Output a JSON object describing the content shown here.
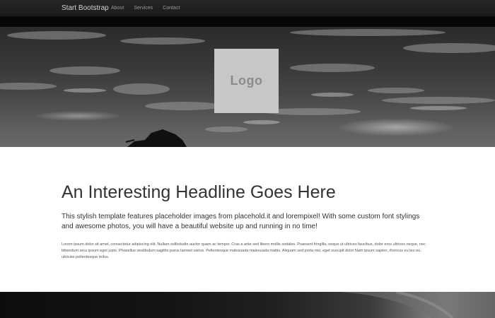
{
  "navbar": {
    "brand": "Start Bootstrap",
    "links": [
      {
        "label": "About"
      },
      {
        "label": "Services"
      },
      {
        "label": "Contact"
      }
    ]
  },
  "hero": {
    "logo_text": "Logo"
  },
  "content": {
    "headline": "An Interesting Headline Goes Here",
    "lead": "This stylish template features placeholder images from placehold.it and lorempixel! With some custom font stylings and awesome photos, you will have a beautiful website up and running in no time!",
    "body": "Lorem ipsum dolor sit amet, consectetur adipiscing elit. Nullam sollicitudin auctor quam ac tempor. Cras a ante sed libero mollis sodales. Praesent fringilla, neque ut ultrices faucibus, dolor eros ultrices neque, nec bibendum arcu ipsum eget justo. Phasellus vestibulum sagittis purus laoreet varius. Pellentesque malesuada malesuada mattis. Aliquam sed porta nisi, eget suscipit dolor Nam ipsum sapien, rhoncus eu leo eu, ultricies pellentesque tellus."
  }
}
